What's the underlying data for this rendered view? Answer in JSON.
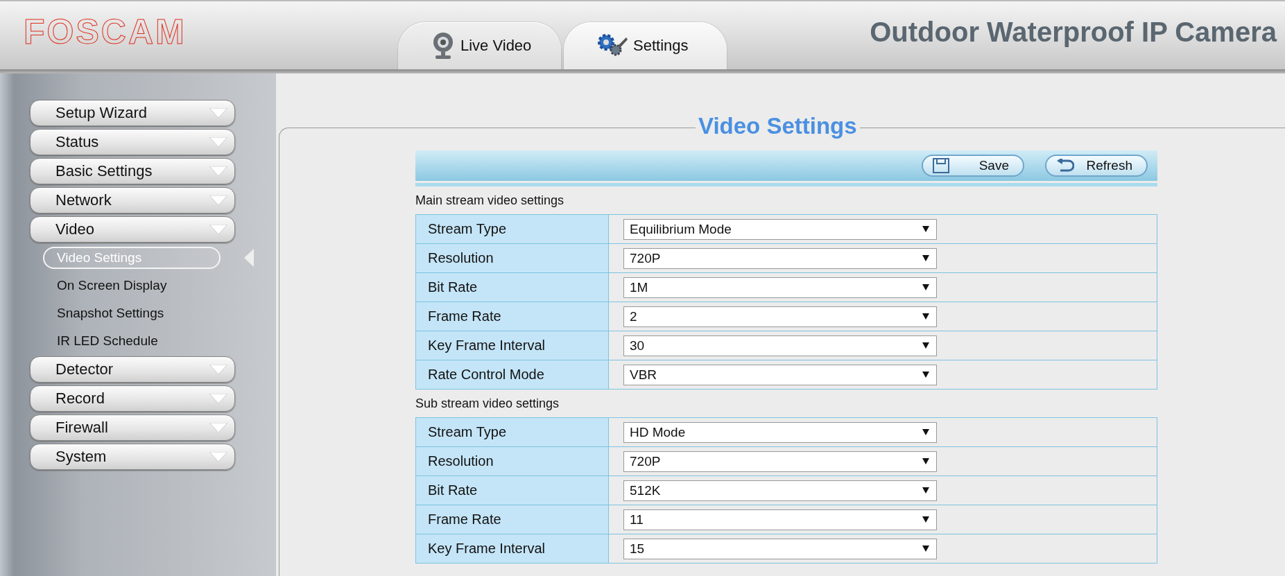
{
  "header": {
    "logo": "FOSCAM",
    "title": "Outdoor Waterproof IP Camera"
  },
  "tabs": [
    {
      "label": "Live Video",
      "selected": false
    },
    {
      "label": "Settings",
      "selected": true
    }
  ],
  "sidebar": {
    "items": [
      {
        "label": "Setup Wizard"
      },
      {
        "label": "Status"
      },
      {
        "label": "Basic Settings"
      },
      {
        "label": "Network"
      },
      {
        "label": "Video",
        "children": [
          {
            "label": "Video Settings",
            "selected": true
          },
          {
            "label": "On Screen Display",
            "selected": false
          },
          {
            "label": "Snapshot Settings",
            "selected": false
          },
          {
            "label": "IR LED Schedule",
            "selected": false
          }
        ]
      },
      {
        "label": "Detector"
      },
      {
        "label": "Record"
      },
      {
        "label": "Firewall"
      },
      {
        "label": "System"
      }
    ]
  },
  "panel": {
    "title": "Video Settings",
    "buttons": [
      {
        "label": "Save"
      },
      {
        "label": "Refresh"
      }
    ],
    "sections": [
      {
        "title": "Main stream video settings",
        "rows": [
          {
            "label": "Stream Type",
            "value": "Equilibrium Mode"
          },
          {
            "label": "Resolution",
            "value": "720P"
          },
          {
            "label": "Bit Rate",
            "value": "1M"
          },
          {
            "label": "Frame Rate",
            "value": "2"
          },
          {
            "label": "Key Frame Interval",
            "value": "30"
          },
          {
            "label": "Rate Control Mode",
            "value": "VBR"
          }
        ]
      },
      {
        "title": "Sub stream video settings",
        "rows": [
          {
            "label": "Stream Type",
            "value": "HD Mode"
          },
          {
            "label": "Resolution",
            "value": "720P"
          },
          {
            "label": "Bit Rate",
            "value": "512K"
          },
          {
            "label": "Frame Rate",
            "value": "11"
          },
          {
            "label": "Key Frame Interval",
            "value": "15"
          }
        ]
      }
    ]
  }
}
